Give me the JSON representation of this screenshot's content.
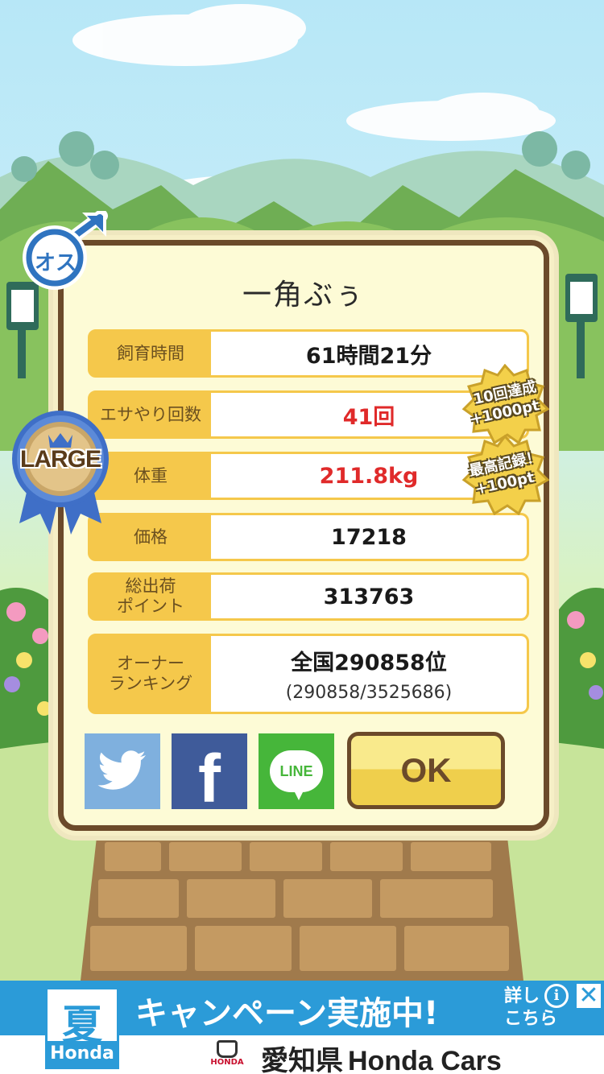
{
  "pig": {
    "name": "一角ぶぅ",
    "gender_badge": "オス"
  },
  "ribbon": {
    "label": "LARGE"
  },
  "stats": [
    {
      "label": "飼育時間",
      "value": "61時間21分"
    },
    {
      "label": "エサやり回数",
      "value": "41回"
    },
    {
      "label": "体重",
      "value": "211.8kg"
    },
    {
      "label": "価格",
      "value": "17218"
    },
    {
      "label": "総出荷\nポイント",
      "value": "313763"
    },
    {
      "label": "オーナー\nランキング",
      "value": "全国290858位",
      "sub": "(290858/3525686)"
    }
  ],
  "badges": [
    {
      "line1": "10回達成",
      "line2": "+1000pt"
    },
    {
      "line1": "最高記録！",
      "line2": "+100pt"
    }
  ],
  "share": {
    "twitter": "twitter",
    "facebook": "f",
    "line": "LINE"
  },
  "ok_label": "OK",
  "ad": {
    "logo_kanji": "夏",
    "logo_brand": "Honda",
    "headline": "キャンペーン実施中!",
    "details_line1": "詳し",
    "details_line2": "こちら",
    "dealer_jp": "愛知県",
    "dealer_en": "Honda Cars",
    "mini_logo": "HONDA"
  },
  "colors": {
    "row_label_bg": "#f5c84b",
    "red_value": "#e02a2a",
    "frame": "#6b4a2a",
    "ad_blue": "#2b9bd8"
  }
}
